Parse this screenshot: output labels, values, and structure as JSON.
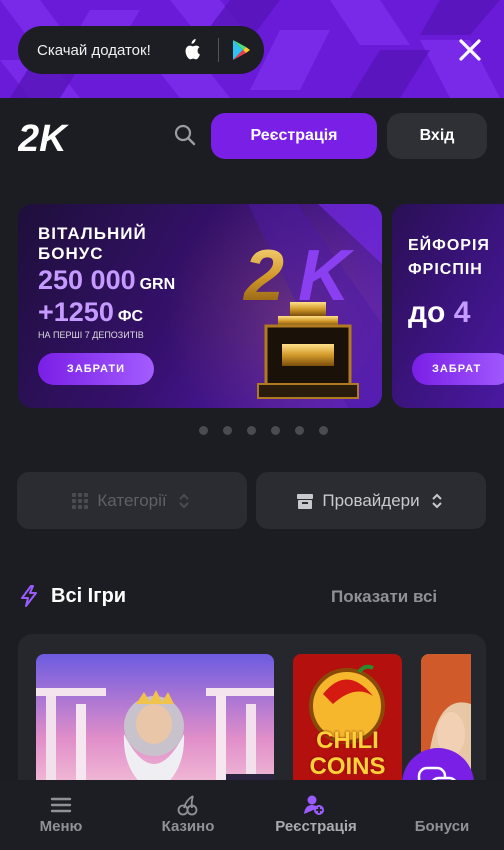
{
  "promo_bar": {
    "download_text": "Скачай додаток!",
    "icons": [
      "apple-icon",
      "google-play-icon",
      "close-icon"
    ]
  },
  "header": {
    "logo_text": "2K",
    "register_label": "Реєстрація",
    "login_label": "Вхід"
  },
  "carousel": {
    "slides": [
      {
        "heading": "ВІТАЛЬНИЙ БОНУС",
        "amount": "250 000",
        "amount_unit": "GRN",
        "freespins": "+1250",
        "freespins_unit": "ФС",
        "note": "НА ПЕРШІ 7 ДЕПОЗИТІВ",
        "button": "ЗАБРАТИ"
      },
      {
        "heading": "ЕЙФОРІЯ ФРІСПІН",
        "value_prefix": "до",
        "value_accent": "4",
        "button": "ЗАБРАТ"
      }
    ],
    "dot_count": 6
  },
  "filters": {
    "categories_label": "Категорії",
    "providers_label": "Провайдери"
  },
  "section": {
    "title": "Всі Ігри",
    "show_all": "Показати всі"
  },
  "games": [
    {
      "name": "Zeus"
    },
    {
      "title_line1": "CHILI",
      "title_line2": "COINS"
    },
    {
      "name": "partial"
    }
  ],
  "bottom_nav": {
    "items": [
      {
        "label": "Меню",
        "icon": "menu-icon"
      },
      {
        "label": "Казино",
        "icon": "cherries-icon"
      },
      {
        "label": "Реєстрація",
        "icon": "add-user-icon"
      },
      {
        "label": "Бонуси",
        "icon": "gift-icon"
      }
    ]
  },
  "colors": {
    "accent": "#7a1fe6",
    "background": "#1c1d22",
    "panel": "#2a2c31"
  }
}
